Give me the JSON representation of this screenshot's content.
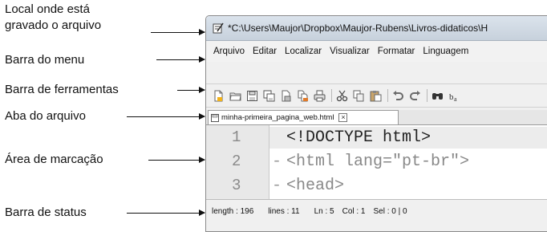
{
  "annotations": {
    "file_location_line1": "Local onde está",
    "file_location_line2": "gravado o arquivo",
    "menu_bar": "Barra do menu",
    "toolbar": "Barra de ferramentas",
    "file_tab": "Aba do arquivo",
    "markup_area": "Área de marcação",
    "status_bar": "Barra de status"
  },
  "window": {
    "title": "*C:\\Users\\Maujor\\Dropbox\\Maujor-Rubens\\Livros-didaticos\\H"
  },
  "menu": {
    "items": [
      "Arquivo",
      "Editar",
      "Localizar",
      "Visualizar",
      "Formatar",
      "Linguagem"
    ]
  },
  "toolbar": {
    "icons": [
      "new-file-icon",
      "open-file-icon",
      "save-icon",
      "save-all-icon",
      "close-icon",
      "close-all-icon",
      "print-icon",
      "cut-icon",
      "copy-icon",
      "paste-icon",
      "undo-icon",
      "redo-icon",
      "find-icon",
      "replace-icon"
    ]
  },
  "tab": {
    "filename": "minha-primeira_pagina_web.html"
  },
  "editor": {
    "lines": [
      {
        "number": "1",
        "prefix": " ",
        "text": "<!DOCTYPE html>"
      },
      {
        "number": "2",
        "prefix": "-",
        "text": "<html lang=\"pt-br\">"
      },
      {
        "number": "3",
        "prefix": "-",
        "text": "<head>"
      }
    ]
  },
  "status": {
    "length": "length : 196",
    "lines": "lines : 11",
    "ln": "Ln : 5",
    "col": "Col : 1",
    "sel": "Sel : 0 | 0"
  }
}
